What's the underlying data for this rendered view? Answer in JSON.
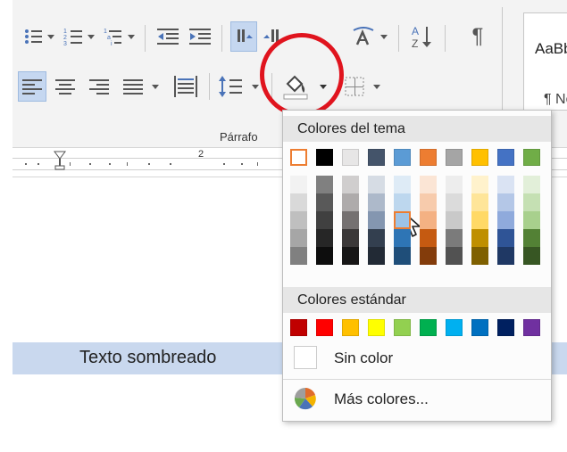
{
  "ribbon": {
    "group_label": "Párrafo",
    "group_launcher": "⌐",
    "style_sample": "AaBb",
    "style_name": "¶ No",
    "paragraph_mark": "¶"
  },
  "ruler": {
    "number": "2"
  },
  "document": {
    "shaded_text": "Texto sombreado"
  },
  "shading_menu": {
    "theme_header": "Colores del tema",
    "standard_header": "Colores estándar",
    "no_color_label": "Sin color",
    "more_colors_label": "Más colores...",
    "theme_top_row": [
      "#ffffff",
      "#000000",
      "#e7e6e6",
      "#44546a",
      "#5b9bd5",
      "#ed7d31",
      "#a5a5a5",
      "#ffc000",
      "#4472c4",
      "#70ad47"
    ],
    "theme_columns": [
      [
        "#f2f2f2",
        "#d9d9d9",
        "#bfbfbf",
        "#a6a6a6",
        "#808080"
      ],
      [
        "#808080",
        "#595959",
        "#404040",
        "#262626",
        "#0d0d0d"
      ],
      [
        "#d0cece",
        "#aeabab",
        "#757171",
        "#3b3838",
        "#171616"
      ],
      [
        "#d6dce4",
        "#adb9ca",
        "#8496b0",
        "#333f4f",
        "#222a35"
      ],
      [
        "#deebf6",
        "#bdd7ee",
        "#9dc3e6",
        "#2e75b5",
        "#1f4e79"
      ],
      [
        "#fbe5d5",
        "#f7cbac",
        "#f4b183",
        "#c55a11",
        "#833c0b"
      ],
      [
        "#ededed",
        "#dbdbdb",
        "#c9c9c9",
        "#7b7b7b",
        "#525252"
      ],
      [
        "#fff2cc",
        "#fee599",
        "#ffd966",
        "#bf8f00",
        "#7f6000"
      ],
      [
        "#dae3f3",
        "#b4c7e7",
        "#8faadc",
        "#2f5496",
        "#1f3864"
      ],
      [
        "#e2efd9",
        "#c5e0b3",
        "#a8d08d",
        "#538135",
        "#375623"
      ]
    ],
    "standard_colors": [
      "#c00000",
      "#ff0000",
      "#ffc000",
      "#ffff00",
      "#92d050",
      "#00b050",
      "#00b0f0",
      "#0070c0",
      "#002060",
      "#7030a0"
    ],
    "selected_theme_color": "#ed7d31",
    "hovered_color": "#9dc3e6",
    "highlight_color": "#e0141e"
  }
}
